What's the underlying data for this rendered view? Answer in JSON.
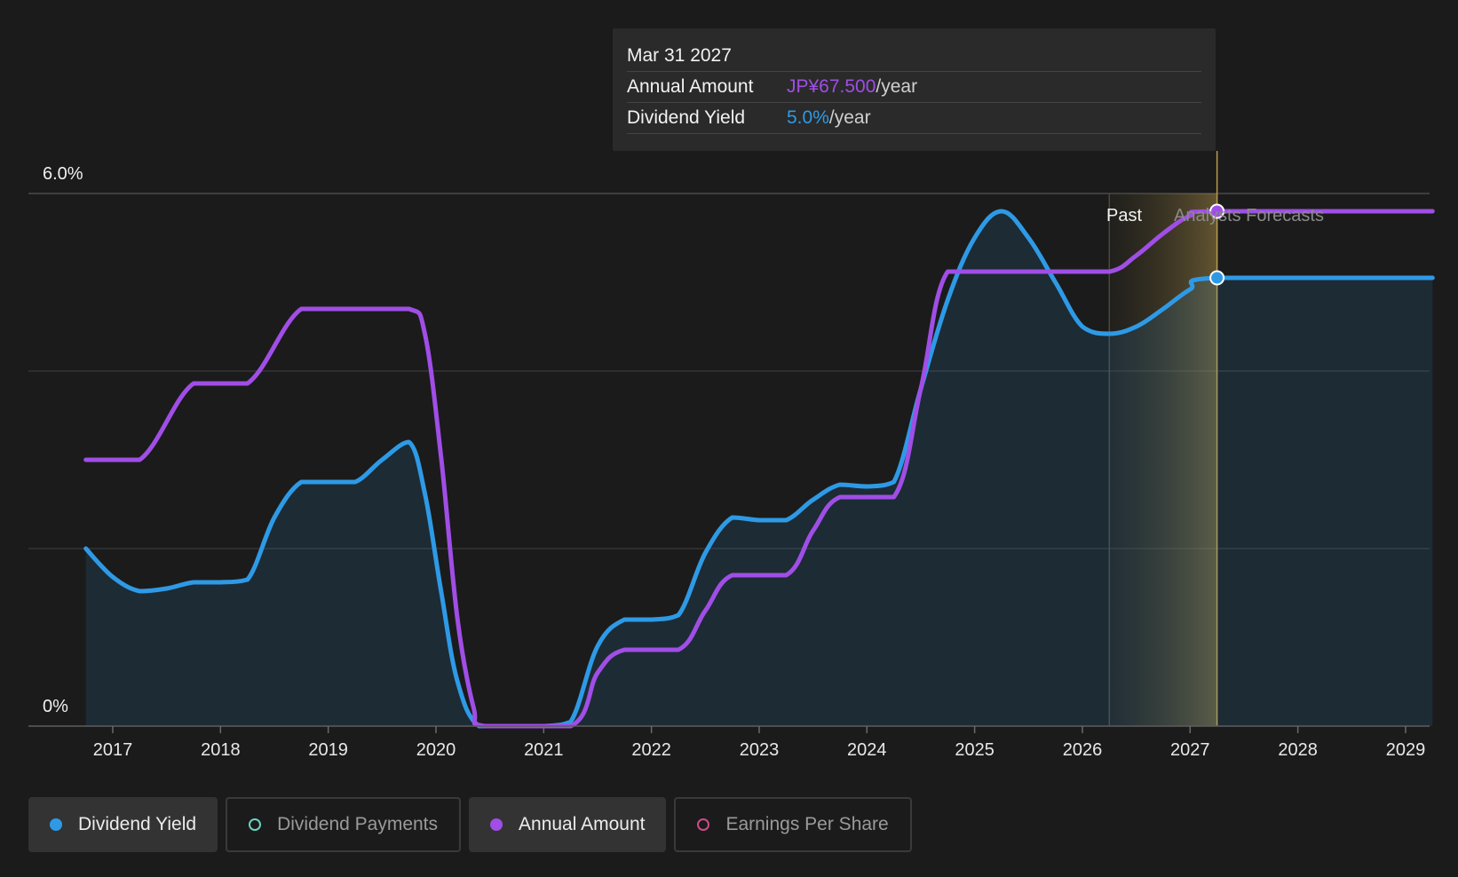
{
  "chart_data": {
    "type": "area",
    "x_ticks": [
      "2017",
      "2018",
      "2019",
      "2020",
      "2021",
      "2022",
      "2023",
      "2024",
      "2025",
      "2026",
      "2027",
      "2028",
      "2029"
    ],
    "y_ticks": [
      "0%",
      "6.0%"
    ],
    "ylim": [
      0,
      6.0
    ],
    "grid": true,
    "regions": {
      "past_label": "Past",
      "forecast_label": "Analysts Forecasts",
      "past_end": "2026.25",
      "marker_x": "2027.25"
    },
    "series": [
      {
        "name": "Dividend Yield",
        "color": "#2e9ae6",
        "points": [
          [
            2016.75,
            2.0
          ],
          [
            2017.0,
            1.68
          ],
          [
            2017.25,
            1.52
          ],
          [
            2017.5,
            1.55
          ],
          [
            2017.75,
            1.62
          ],
          [
            2018.0,
            1.62
          ],
          [
            2018.25,
            1.65
          ],
          [
            2018.5,
            2.35
          ],
          [
            2018.75,
            2.75
          ],
          [
            2019.0,
            2.75
          ],
          [
            2019.25,
            2.75
          ],
          [
            2019.5,
            3.0
          ],
          [
            2019.75,
            3.2
          ],
          [
            2019.9,
            2.6
          ],
          [
            2020.05,
            1.5
          ],
          [
            2020.2,
            0.5
          ],
          [
            2020.4,
            0.0
          ],
          [
            2020.75,
            0.0
          ],
          [
            2021.0,
            0.0
          ],
          [
            2021.25,
            0.05
          ],
          [
            2021.5,
            0.9
          ],
          [
            2021.75,
            1.2
          ],
          [
            2022.0,
            1.2
          ],
          [
            2022.25,
            1.25
          ],
          [
            2022.5,
            1.95
          ],
          [
            2022.75,
            2.35
          ],
          [
            2023.0,
            2.32
          ],
          [
            2023.25,
            2.32
          ],
          [
            2023.5,
            2.55
          ],
          [
            2023.75,
            2.72
          ],
          [
            2024.0,
            2.7
          ],
          [
            2024.25,
            2.75
          ],
          [
            2024.5,
            3.8
          ],
          [
            2024.75,
            4.8
          ],
          [
            2025.0,
            5.5
          ],
          [
            2025.25,
            5.8
          ],
          [
            2025.5,
            5.5
          ],
          [
            2025.75,
            5.0
          ],
          [
            2026.0,
            4.5
          ],
          [
            2026.25,
            4.42
          ],
          [
            2026.5,
            4.5
          ],
          [
            2026.75,
            4.7
          ],
          [
            2027.0,
            4.92
          ],
          [
            2027.25,
            5.05
          ],
          [
            2029.25,
            5.05
          ]
        ]
      },
      {
        "name": "Annual Amount",
        "color": "#a04ee6",
        "points": [
          [
            2016.75,
            3.0
          ],
          [
            2017.25,
            3.0
          ],
          [
            2017.75,
            3.86
          ],
          [
            2018.25,
            3.86
          ],
          [
            2018.75,
            4.7
          ],
          [
            2019.25,
            4.7
          ],
          [
            2019.75,
            4.7
          ],
          [
            2019.9,
            4.4
          ],
          [
            2020.05,
            3.0
          ],
          [
            2020.2,
            1.2
          ],
          [
            2020.35,
            0.2
          ],
          [
            2020.45,
            0.0
          ],
          [
            2021.25,
            0.0
          ],
          [
            2021.5,
            0.6
          ],
          [
            2021.75,
            0.86
          ],
          [
            2022.25,
            0.86
          ],
          [
            2022.5,
            1.3
          ],
          [
            2022.75,
            1.7
          ],
          [
            2023.25,
            1.7
          ],
          [
            2023.5,
            2.2
          ],
          [
            2023.75,
            2.58
          ],
          [
            2024.25,
            2.58
          ],
          [
            2024.5,
            3.8
          ],
          [
            2024.75,
            5.12
          ],
          [
            2025.25,
            5.12
          ],
          [
            2025.75,
            5.12
          ],
          [
            2026.25,
            5.12
          ],
          [
            2026.5,
            5.3
          ],
          [
            2026.75,
            5.55
          ],
          [
            2027.0,
            5.75
          ],
          [
            2027.25,
            5.8
          ],
          [
            2029.25,
            5.8
          ]
        ]
      }
    ]
  },
  "tooltip": {
    "date": "Mar 31 2027",
    "rows": [
      {
        "label": "Annual Amount",
        "value": "JP¥67.500",
        "unit": "/year"
      },
      {
        "label": "Dividend Yield",
        "value": "5.0%",
        "unit": "/year"
      }
    ]
  },
  "legend": {
    "items": [
      {
        "label": "Dividend Yield",
        "color": "#2e9ae6",
        "active": true,
        "filled": true
      },
      {
        "label": "Dividend Payments",
        "color": "#6fd0c0",
        "active": false,
        "filled": false
      },
      {
        "label": "Annual Amount",
        "color": "#a04ee6",
        "active": true,
        "filled": true
      },
      {
        "label": "Earnings Per Share",
        "color": "#d04a8a",
        "active": false,
        "filled": false
      }
    ]
  }
}
